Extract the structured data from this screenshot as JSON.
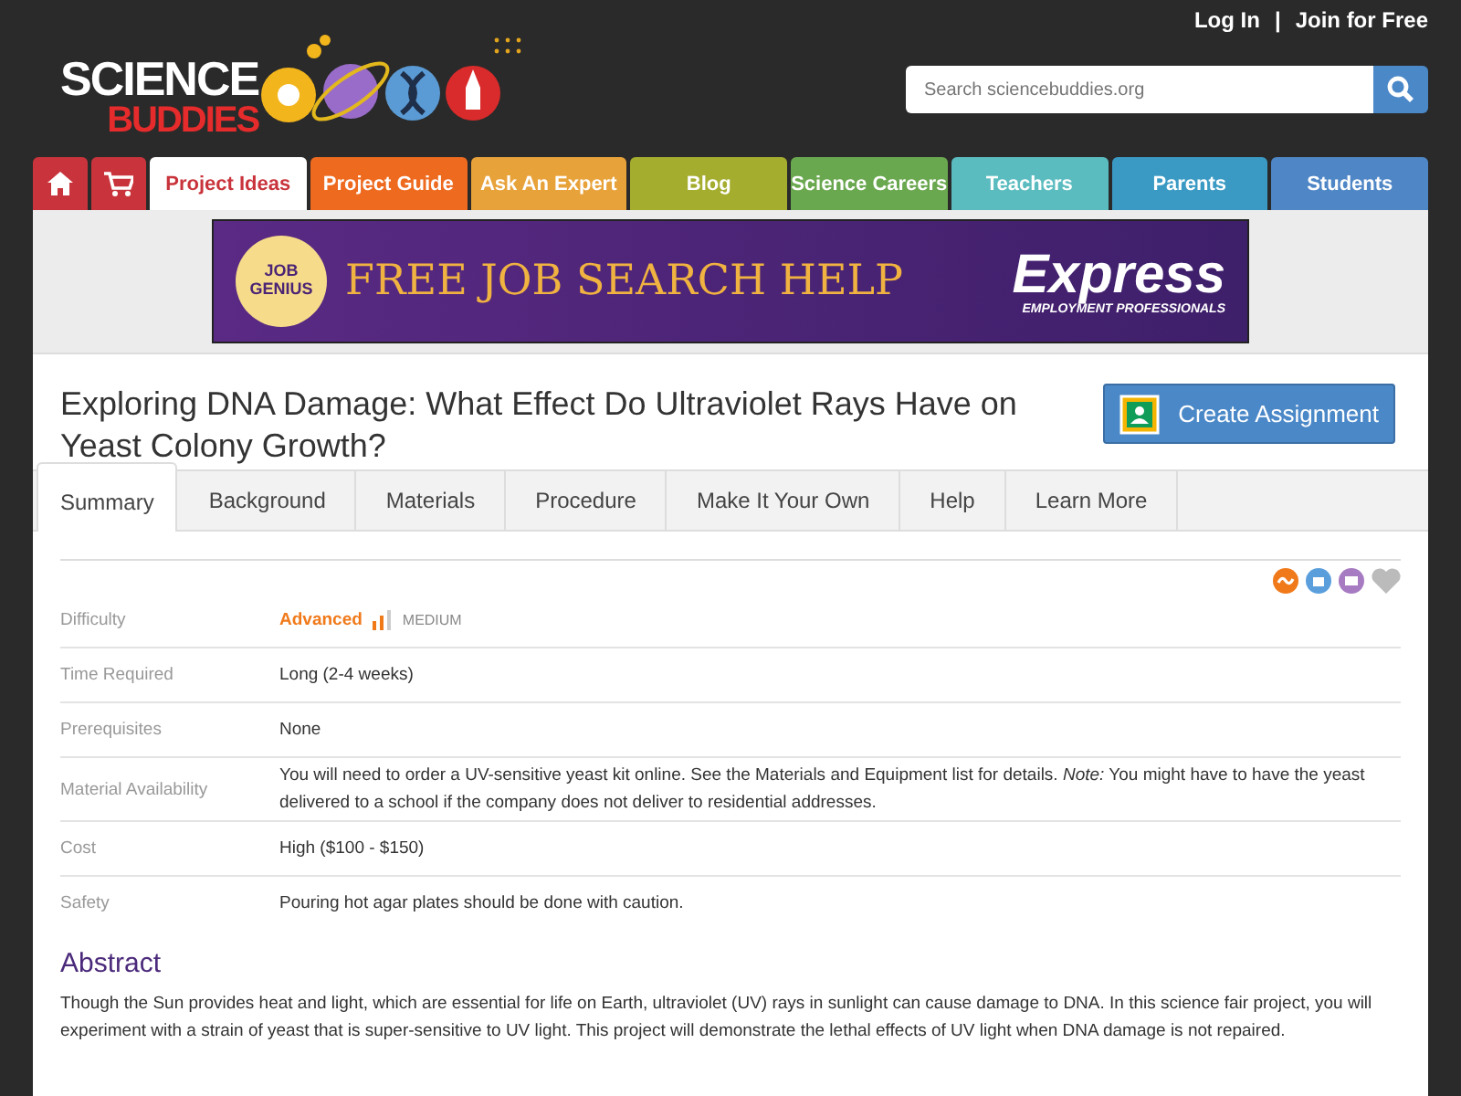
{
  "header": {
    "logo": [
      "SCIENCE",
      "BUDDIES"
    ],
    "links": [
      "Log In",
      "|",
      "Join for Free"
    ],
    "search": {
      "placeholder": "Search sciencebuddies.org"
    }
  },
  "nav": {
    "icon_tabs": [
      {
        "kind": "home",
        "color": "#c9343c"
      },
      {
        "kind": "cart",
        "color": "#c9343c"
      }
    ],
    "tabs": [
      {
        "label": "Project Ideas",
        "selected": true,
        "color": "#c9343c"
      },
      {
        "label": "Project Guide",
        "selected": false,
        "color": "#ee6a1f"
      },
      {
        "label": "Ask An Expert",
        "selected": false,
        "color": "#e8a23a"
      },
      {
        "label": "Blog",
        "selected": false,
        "color": "#a5ad2f"
      },
      {
        "label": "Science Careers",
        "selected": false,
        "color": "#6aa84f"
      },
      {
        "label": "Teachers",
        "selected": false,
        "color": "#5bbcc0"
      },
      {
        "label": "Parents",
        "selected": false,
        "color": "#3a9ac4"
      },
      {
        "label": "Students",
        "selected": false,
        "color": "#4f86c6"
      }
    ]
  },
  "ad": {
    "badge": [
      "JOB",
      "GENIUS"
    ],
    "headline": "FREE JOB SEARCH HELP",
    "brand": "Express",
    "tagline": "EMPLOYMENT PROFESSIONALS"
  },
  "title": "Exploring DNA Damage: What Effect Do Ultraviolet Rays Have on Yeast Colony Growth?",
  "create_button": "Create Assignment",
  "tabs": [
    {
      "label": "Summary",
      "selected": true
    },
    {
      "label": "Background",
      "selected": false
    },
    {
      "label": "Materials",
      "selected": false
    },
    {
      "label": "Procedure",
      "selected": false
    },
    {
      "label": "Make It Your Own",
      "selected": false
    },
    {
      "label": "Help",
      "selected": false
    },
    {
      "label": "Learn More",
      "selected": false
    }
  ],
  "details": [
    {
      "kind": "difficulty",
      "label": "Difficulty",
      "value": "Advanced",
      "level_text": "MEDIUM"
    },
    {
      "kind": "text",
      "label": "Time Required",
      "value": "Long (2-4 weeks)"
    },
    {
      "kind": "text",
      "label": "Prerequisites",
      "value": "None"
    },
    {
      "kind": "text",
      "label": "Material Availability",
      "value": "You will need to order a UV-sensitive yeast kit online. See the Materials and Equipment list for details. *Note:* You might have to have the yeast delivered to a school if the company does not deliver to residential addresses."
    },
    {
      "kind": "text",
      "label": "Cost",
      "value": "High ($100 - $150)"
    },
    {
      "kind": "text",
      "label": "Safety",
      "value": "Pouring hot agar plates should be done with caution."
    }
  ],
  "abstract": {
    "heading": "Abstract",
    "text": "Though the Sun provides heat and light, which are essential for life on Earth, ultraviolet (UV) rays in sunlight can cause damage to DNA. In this science fair project, you will experiment with a strain of yeast that is super-sensitive to UV light. This project will demonstrate the lethal effects of UV light when DNA damage is not repaired."
  }
}
